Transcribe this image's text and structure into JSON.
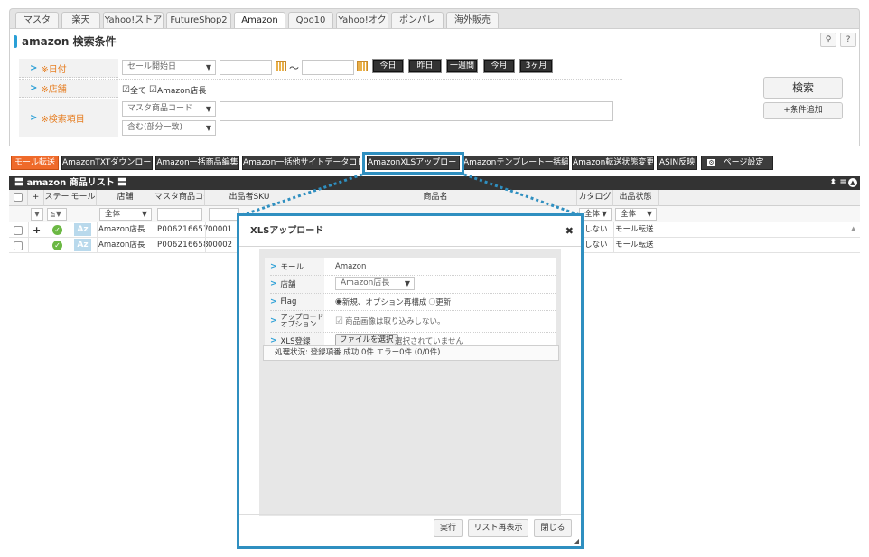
{
  "tabs": [
    "マスタ",
    "楽天",
    "Yahoo!ストア",
    "FutureShop2",
    "Amazon",
    "Qoo10",
    "Yahoo!オク",
    "ポンパレ",
    "海外販売"
  ],
  "active_tab": "Amazon",
  "search": {
    "title": "amazon 検索条件",
    "date_label": "※日付",
    "date_select": "セール開始日",
    "tilde": "～",
    "date_buttons": [
      "今日",
      "昨日",
      "一週間",
      "今月",
      "3ヶ月"
    ],
    "store_label": "※店舗",
    "store_all": "全て",
    "store_amazon": "Amazon店長",
    "item_label": "※検索項目",
    "item_select": "マスタ商品コード",
    "match_select": "含む(部分一致)",
    "search_button": "検索",
    "add_condition_button": "+条件追加"
  },
  "toolbar": {
    "buttons": [
      "モール転送",
      "AmazonTXTダウンロード",
      "Amazon一括商品編集",
      "Amazon一括他サイトデータコピー",
      "AmazonXLSアップロード",
      "Amazonテンプレート一括編集",
      "Amazon転送状態変更",
      "ASIN反映",
      "ページ設定"
    ]
  },
  "list": {
    "title": "〓 amazon 商品リスト 〓",
    "columns": [
      "+",
      "ステー",
      "モール",
      "店舗",
      "マスタ商品コー",
      "出品者SKU",
      "商品名",
      "カタログ",
      "出品状態"
    ],
    "filter_all": "全体",
    "rows": [
      {
        "plus": "+",
        "mall": "Az",
        "store": "Amazon店長",
        "code": "P006216657",
        "sku": "00001",
        "catalog": "しない",
        "state": "モール転送"
      },
      {
        "plus": "",
        "mall": "Az",
        "store": "Amazon店長",
        "code": "P006216658",
        "sku": "00002",
        "catalog": "しない",
        "state": "モール転送"
      }
    ]
  },
  "modal": {
    "title": "XLSアップロード",
    "close": "✖",
    "mall_label": "モール",
    "mall_value": "Amazon",
    "store_label": "店舗",
    "store_value": "Amazon店長",
    "flag_label": "Flag",
    "flag_option1": "新規、オプション再構成",
    "flag_option2": "更新",
    "upload_option_label1": "アップロード",
    "upload_option_label2": "オプション",
    "upload_option_value": "商品画像は取り込みしない。",
    "xls_label": "XLS登録",
    "file_button": "ファイルを選択",
    "file_status": "選択されていません",
    "status_text": "処理状況: 登録項番 成功 0件 エラー0件 (0/0件)",
    "buttons": [
      "実行",
      "リスト再表示",
      "閉じる"
    ]
  },
  "colors": {
    "accent": "#2f8fc0",
    "orange": "#ef6a2a",
    "dark": "#3c3c3c"
  }
}
